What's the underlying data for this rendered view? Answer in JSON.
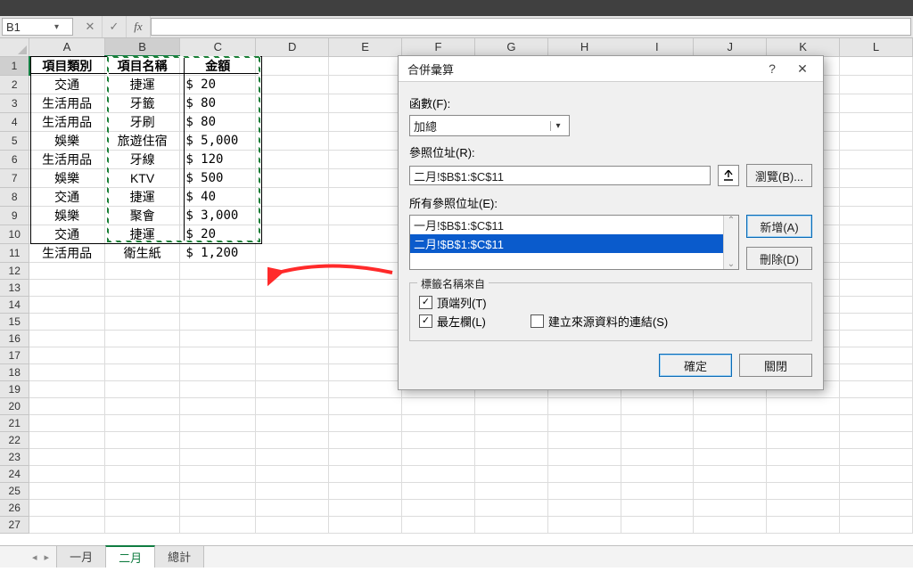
{
  "colors": {
    "accent_green": "#107c41",
    "selection_blue": "#0a5bcc",
    "arrow_red": "#ff2a2a"
  },
  "name_box": "B1",
  "columns": [
    "A",
    "B",
    "C",
    "D",
    "E",
    "F",
    "G",
    "H",
    "I",
    "J",
    "K",
    "L"
  ],
  "selected_column": "B",
  "selected_row": "1",
  "rows_visible": 27,
  "headers": {
    "c0": "項目類別",
    "c1": "項目名稱",
    "c2": "金額"
  },
  "data": [
    {
      "c0": "交通",
      "c1": "捷運",
      "c2": "$     20"
    },
    {
      "c0": "生活用品",
      "c1": "牙籤",
      "c2": "$     80"
    },
    {
      "c0": "生活用品",
      "c1": "牙刷",
      "c2": "$     80"
    },
    {
      "c0": "娛樂",
      "c1": "旅遊住宿",
      "c2": "$  5,000"
    },
    {
      "c0": "生活用品",
      "c1": "牙線",
      "c2": "$    120"
    },
    {
      "c0": "娛樂",
      "c1": "KTV",
      "c2": "$    500"
    },
    {
      "c0": "交通",
      "c1": "捷運",
      "c2": "$     40"
    },
    {
      "c0": "娛樂",
      "c1": "聚會",
      "c2": "$  3,000"
    },
    {
      "c0": "交通",
      "c1": "捷運",
      "c2": "$     20"
    },
    {
      "c0": "生活用品",
      "c1": "衛生紙",
      "c2": "$  1,200"
    }
  ],
  "sheet_tabs": {
    "items": [
      "一月",
      "二月",
      "總計"
    ],
    "active": "二月"
  },
  "dialog": {
    "title": "合併彙算",
    "labels": {
      "function": "函數(F):",
      "reference": "參照位址(R):",
      "all_references": "所有參照位址(E):",
      "group": "標籤名稱來自",
      "top_row": "頂端列(T)",
      "left_col": "最左欄(L)",
      "create_links": "建立來源資料的連結(S)"
    },
    "function_value": "加總",
    "reference_value": "二月!$B$1:$C$11",
    "reference_list": [
      "一月!$B$1:$C$11",
      "二月!$B$1:$C$11"
    ],
    "reference_selected_index": 1,
    "checks": {
      "top_row": true,
      "left_col": true,
      "create_links": false
    },
    "buttons": {
      "browse": "瀏覽(B)...",
      "add": "新增(A)",
      "delete": "刪除(D)",
      "ok": "確定",
      "close": "關閉"
    }
  }
}
